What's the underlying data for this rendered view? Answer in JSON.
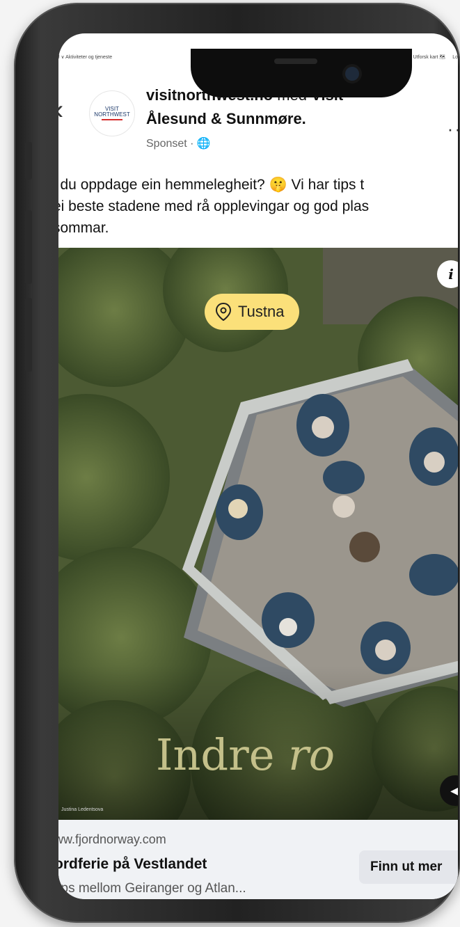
{
  "topbar": {
    "left": "l ∨  Aktiviteter og tjeneste",
    "right_items": [
      "Q",
      "Utforsk kart 🗺",
      "Lo"
    ]
  },
  "post": {
    "page_name": "visitnorthwest.no",
    "with_text": "med",
    "partner_line1": "Visit",
    "partner_line2": "Ålesund & Sunnmøre.",
    "sponsored": "Sponset · 🌐",
    "avatar_text_1": "VISIT",
    "avatar_text_2": "NORTHWEST",
    "body_lines": [
      "l du oppdage ein hemmelegheit? 🤫 Vi har tips t",
      "ei beste stadene med rå opplevingar og god plas",
      "sommar."
    ]
  },
  "media": {
    "location": "Tustna",
    "overlay_word1": "Indre",
    "overlay_word2": "ro",
    "credit": "Justina Ledentsova",
    "info_icon": "info-icon",
    "sound_icon": "speaker-icon"
  },
  "cta": {
    "domain": "ww.fjordnorway.com",
    "title": "ordferie på Vestlandet",
    "description": "tips mellom Geiranger og Atlan...",
    "button_label": "Finn ut mer"
  },
  "colors": {
    "location_pill": "#fbe07a",
    "overlay_text": "#c4c08a",
    "cta_background": "#f0f2f5"
  }
}
